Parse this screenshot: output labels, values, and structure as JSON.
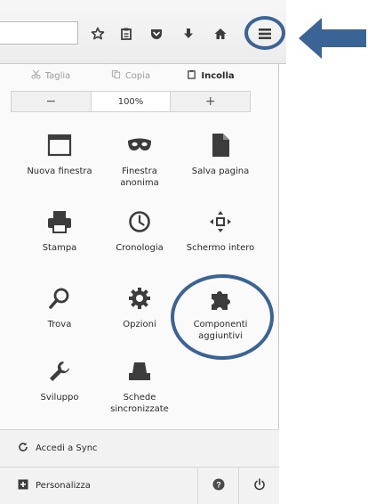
{
  "colors": {
    "highlight": "#3a6396",
    "icon": "#3c3c3c"
  },
  "toolbar": {
    "icons": [
      "star-icon",
      "clipboard-icon",
      "pocket-icon",
      "download-icon",
      "home-icon",
      "hamburger-menu-icon"
    ]
  },
  "panel": {
    "edit": {
      "cut_label": "Taglia",
      "copy_label": "Copia",
      "paste_label": "Incolla"
    },
    "zoom": {
      "minus": "−",
      "value": "100%",
      "plus": "+"
    },
    "items": [
      {
        "id": "new-window",
        "label": "Nuova finestra",
        "icon": "window-icon"
      },
      {
        "id": "private-window",
        "label": "Finestra anonima",
        "icon": "mask-icon"
      },
      {
        "id": "save-page",
        "label": "Salva pagina",
        "icon": "page-icon"
      },
      {
        "id": "print",
        "label": "Stampa",
        "icon": "printer-icon"
      },
      {
        "id": "history",
        "label": "Cronologia",
        "icon": "clock-icon"
      },
      {
        "id": "fullscreen",
        "label": "Schermo intero",
        "icon": "fullscreen-icon"
      },
      {
        "id": "find",
        "label": "Trova",
        "icon": "magnifier-icon"
      },
      {
        "id": "options",
        "label": "Opzioni",
        "icon": "gear-icon"
      },
      {
        "id": "addons",
        "label": "Componenti aggiuntivi",
        "icon": "puzzle-icon"
      },
      {
        "id": "developer",
        "label": "Sviluppo",
        "icon": "wrench-icon"
      },
      {
        "id": "synced-tabs",
        "label": "Schede sincronizzate",
        "icon": "synced-tabs-icon"
      }
    ],
    "sync_label": "Accedi a Sync",
    "customize_label": "Personalizza"
  }
}
